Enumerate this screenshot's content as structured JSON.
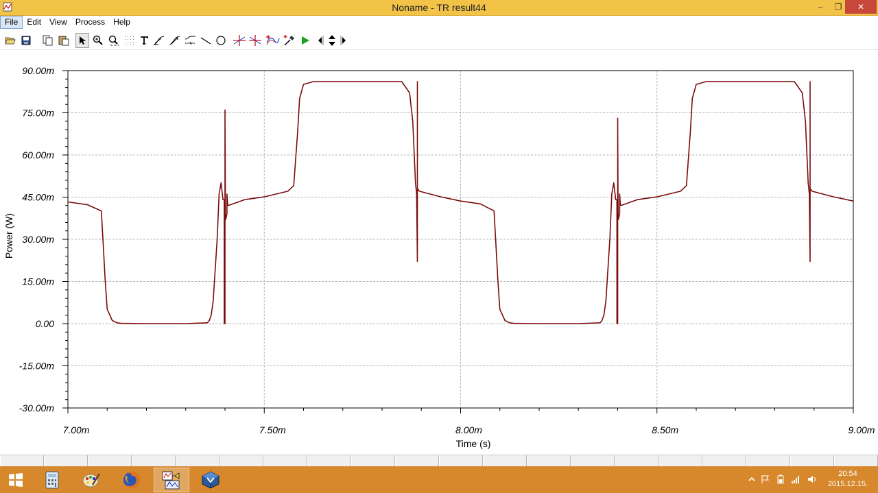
{
  "window": {
    "title": "Noname - TR result44",
    "minimize_glyph": "–",
    "maximize_glyph": "❐",
    "close_glyph": "✕"
  },
  "menu": {
    "items": [
      "File",
      "Edit",
      "View",
      "Process",
      "Help"
    ],
    "active_index": 0
  },
  "toolbar": {
    "tools": [
      "open-icon",
      "save-icon",
      "copy-icon",
      "paste-icon",
      "pointer-icon",
      "zoom-in-icon",
      "zoom-100-icon",
      "grid-icon",
      "text-icon",
      "curve-tool-icon",
      "curve-tool-2-icon",
      "line-style-icon",
      "line-icon",
      "circle-icon",
      "cursor-a-icon",
      "cursor-b-icon",
      "add-curve-icon",
      "probe-icon",
      "run-icon",
      "move-left-icon",
      "move-up-down-icon",
      "move-right-icon"
    ],
    "pressed": "pointer-icon"
  },
  "colors": {
    "trace": "#7a0a0a",
    "grid": "#b4b4b4",
    "titlebar": "#f2c347",
    "taskbar": "#d7882d",
    "run": "#1aa01a"
  },
  "chart_data": {
    "type": "line",
    "title": "",
    "xlabel": "Time (s)",
    "ylabel": "Power (W)",
    "xlim": [
      0.007,
      0.009
    ],
    "ylim": [
      -0.03,
      0.09
    ],
    "xticks": [
      0.007,
      0.0075,
      0.008,
      0.0085,
      0.009
    ],
    "xtick_labels": [
      "7.00m",
      "7.50m",
      "8.00m",
      "8.50m",
      "9.00m"
    ],
    "yticks": [
      0.09,
      0.075,
      0.06,
      0.045,
      0.03,
      0.015,
      0.0,
      -0.015,
      -0.03
    ],
    "ytick_labels": [
      "90.00m",
      "75.00m",
      "60.00m",
      "45.00m",
      "30.00m",
      "15.00m",
      "0.00",
      "-15.00m",
      "-30.00m"
    ],
    "grid": true,
    "series": [
      {
        "x": [
          0.007,
          0.00705,
          0.007085,
          0.00709,
          0.007095,
          0.0071,
          0.007113,
          0.007125,
          0.007135,
          0.0072,
          0.0073,
          0.007355,
          0.00736,
          0.007365,
          0.00737,
          0.00738,
          0.007385,
          0.00739,
          0.007395,
          0.007398,
          0.007398,
          0.0074,
          0.0074,
          0.007401,
          0.007402,
          0.007405,
          0.007405,
          0.007407,
          0.00741,
          0.00745,
          0.0075,
          0.00756,
          0.007575,
          0.007585,
          0.00759,
          0.0076,
          0.007625,
          0.00765,
          0.0077,
          0.00775,
          0.0078,
          0.00785,
          0.00787,
          0.007878,
          0.007882,
          0.007885,
          0.007888,
          0.00789,
          0.00789,
          0.00789,
          0.00789,
          0.007895,
          0.00795,
          0.008,
          0.00805,
          0.008085,
          0.00809,
          0.008095,
          0.0081,
          0.008113,
          0.008125,
          0.008135,
          0.0082,
          0.0083,
          0.008355,
          0.00836,
          0.008365,
          0.00837,
          0.00838,
          0.008385,
          0.00839,
          0.008395,
          0.008398,
          0.008398,
          0.0084,
          0.0084,
          0.008401,
          0.008402,
          0.008405,
          0.008405,
          0.008407,
          0.00841,
          0.00845,
          0.0085,
          0.00856,
          0.008575,
          0.008585,
          0.00859,
          0.0086,
          0.008625,
          0.00865,
          0.0087,
          0.00875,
          0.0088,
          0.00885,
          0.00887,
          0.008878,
          0.008882,
          0.008885,
          0.008888,
          0.00889,
          0.00889,
          0.00889,
          0.00889,
          0.008895,
          0.00895,
          0.009
        ],
        "y": [
          0.0433,
          0.0423,
          0.0401,
          0.0281,
          0.0151,
          0.0051,
          0.0011,
          0.0003,
          0.0001,
          0.0,
          0.0,
          0.0003,
          0.0011,
          0.0031,
          0.0081,
          0.0301,
          0.0461,
          0.0501,
          0.0441,
          0.0441,
          0.0,
          0.0,
          0.076,
          0.0391,
          0.0371,
          0.0391,
          0.0461,
          0.0421,
          0.0421,
          0.0441,
          0.0451,
          0.0471,
          0.0491,
          0.0681,
          0.0801,
          0.0851,
          0.0861,
          0.0861,
          0.0861,
          0.0861,
          0.0861,
          0.0861,
          0.0821,
          0.0721,
          0.0601,
          0.0501,
          0.0461,
          0.0221,
          0.0861,
          0.0441,
          0.0481,
          0.0471,
          0.0451,
          0.0436,
          0.0426,
          0.0401,
          0.0281,
          0.0151,
          0.0051,
          0.0011,
          0.0003,
          0.0001,
          0.0,
          0.0,
          0.0003,
          0.0011,
          0.0031,
          0.0081,
          0.0301,
          0.0461,
          0.0501,
          0.0441,
          0.0441,
          0.0,
          0.0,
          0.0731,
          0.0391,
          0.0371,
          0.0391,
          0.0461,
          0.0421,
          0.0421,
          0.0441,
          0.0451,
          0.0471,
          0.0491,
          0.0681,
          0.0801,
          0.0851,
          0.0861,
          0.0861,
          0.0861,
          0.0861,
          0.0861,
          0.0861,
          0.0821,
          0.0721,
          0.0601,
          0.0501,
          0.0461,
          0.0221,
          0.0861,
          0.0441,
          0.0481,
          0.0471,
          0.0451,
          0.0436
        ]
      }
    ]
  },
  "tabstrip": {
    "cells": 20
  },
  "taskbar": {
    "apps": [
      "windows-start-icon",
      "calculator-icon",
      "paint-icon",
      "firefox-icon",
      "tina-icon",
      "virtualbox-icon"
    ],
    "active_index": 4,
    "tray_icons": [
      "tray-up-arrow-icon",
      "flag-icon",
      "battery-icon",
      "signal-icon",
      "volume-icon"
    ],
    "time": "20:54",
    "date": "2015.12.15."
  }
}
